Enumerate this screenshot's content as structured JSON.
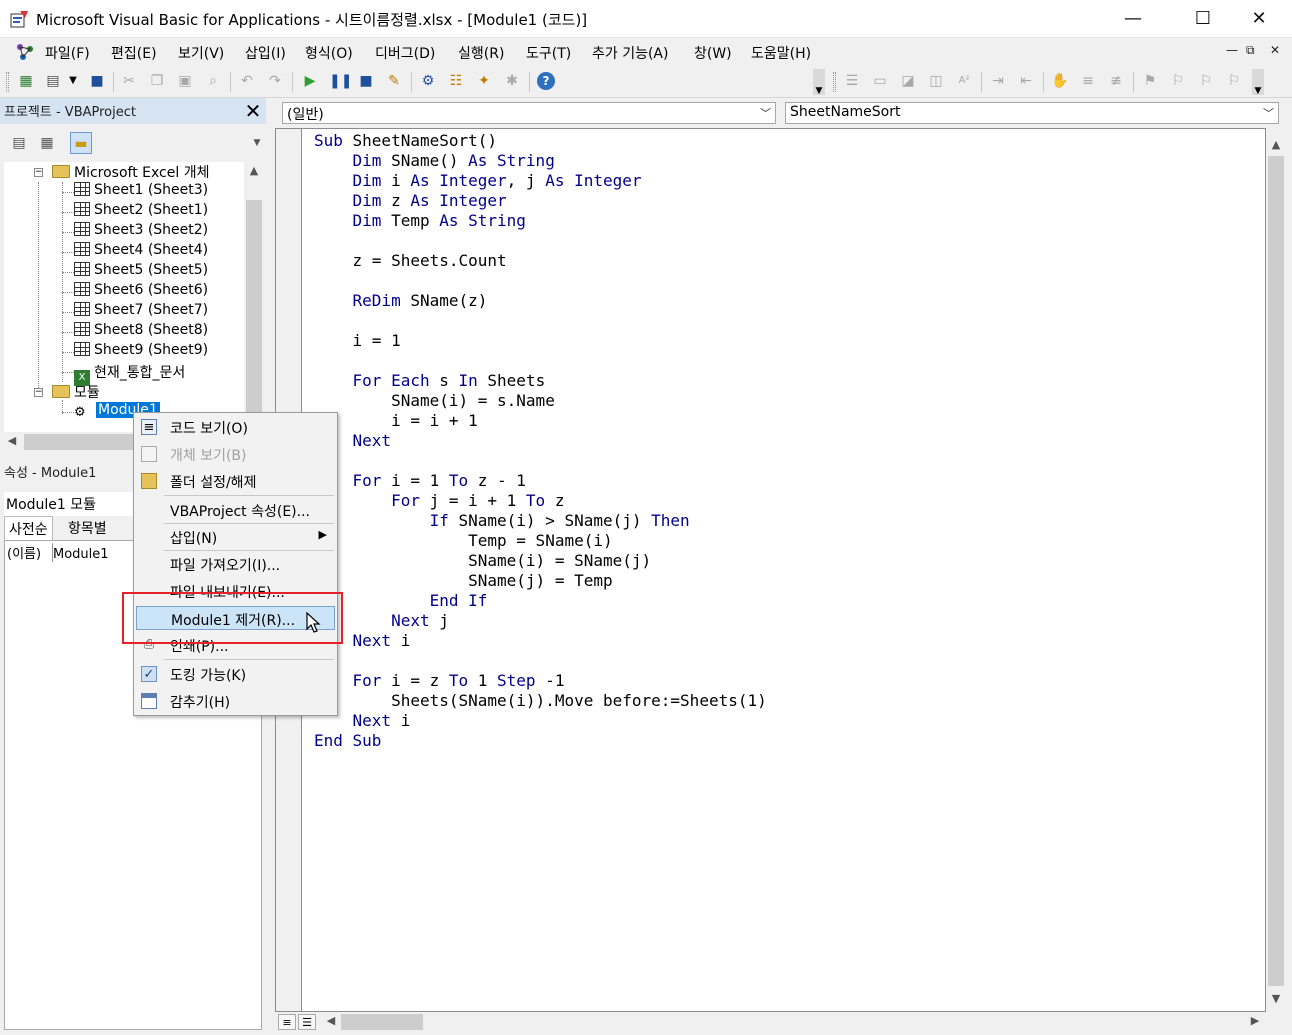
{
  "window": {
    "title": "Microsoft Visual Basic for Applications - 시트이름정렬.xlsx - [Module1 (코드)]",
    "minimize": "—",
    "maximize": "☐",
    "close": "✕"
  },
  "menu": {
    "items": [
      "파일(F)",
      "편집(E)",
      "보기(V)",
      "삽입(I)",
      "형식(O)",
      "디버그(D)",
      "실행(R)",
      "도구(T)",
      "추가 기능(A)",
      "창(W)",
      "도움말(H)"
    ],
    "mdi_min": "—",
    "mdi_restore": "⧉",
    "mdi_close": "✕"
  },
  "project": {
    "title": "프로젝트 - VBAProject",
    "close": "✕",
    "tree": {
      "excel_objects": "Microsoft Excel 개체",
      "sheets": [
        "Sheet1 (Sheet3)",
        "Sheet2 (Sheet1)",
        "Sheet3 (Sheet2)",
        "Sheet4 (Sheet4)",
        "Sheet5 (Sheet5)",
        "Sheet6 (Sheet6)",
        "Sheet7 (Sheet7)",
        "Sheet8 (Sheet8)",
        "Sheet9 (Sheet9)"
      ],
      "workbook": "현재_통합_문서",
      "modules_folder": "모듈",
      "module": "Module1"
    }
  },
  "properties": {
    "title": "속성 - Module1",
    "object": "Module1 모듈",
    "tab_alpha": "사전순",
    "tab_category": "항목별",
    "name_key": "(이름)",
    "name_value": "Module1"
  },
  "code": {
    "object_combo": "(일반)",
    "procedure_combo": "SheetNameSort",
    "lines": [
      [
        [
          "kw",
          "Sub "
        ],
        [
          "",
          "SheetNameSort()"
        ]
      ],
      [
        [
          "",
          "    "
        ],
        [
          "kw",
          "Dim "
        ],
        [
          "",
          "SName() "
        ],
        [
          "kw",
          "As String"
        ]
      ],
      [
        [
          "",
          "    "
        ],
        [
          "kw",
          "Dim "
        ],
        [
          "",
          "i "
        ],
        [
          "kw",
          "As Integer"
        ],
        [
          "",
          ", j "
        ],
        [
          "kw",
          "As Integer"
        ]
      ],
      [
        [
          "",
          "    "
        ],
        [
          "kw",
          "Dim "
        ],
        [
          "",
          "z "
        ],
        [
          "kw",
          "As Integer"
        ]
      ],
      [
        [
          "",
          "    "
        ],
        [
          "kw",
          "Dim "
        ],
        [
          "",
          "Temp "
        ],
        [
          "kw",
          "As String"
        ]
      ],
      [
        [
          "",
          ""
        ]
      ],
      [
        [
          "",
          "    z = Sheets.Count"
        ]
      ],
      [
        [
          "",
          ""
        ]
      ],
      [
        [
          "",
          "    "
        ],
        [
          "kw",
          "ReDim "
        ],
        [
          "",
          "SName(z)"
        ]
      ],
      [
        [
          "",
          ""
        ]
      ],
      [
        [
          "",
          "    i = 1"
        ]
      ],
      [
        [
          "",
          ""
        ]
      ],
      [
        [
          "",
          "    "
        ],
        [
          "kw",
          "For Each "
        ],
        [
          "",
          "s "
        ],
        [
          "kw",
          "In "
        ],
        [
          "",
          "Sheets"
        ]
      ],
      [
        [
          "",
          "        SName(i) = s.Name"
        ]
      ],
      [
        [
          "",
          "        i = i + 1"
        ]
      ],
      [
        [
          "",
          "    "
        ],
        [
          "kw",
          "Next"
        ]
      ],
      [
        [
          "",
          ""
        ]
      ],
      [
        [
          "",
          "    "
        ],
        [
          "kw",
          "For "
        ],
        [
          "",
          "i = 1 "
        ],
        [
          "kw",
          "To "
        ],
        [
          "",
          "z - 1"
        ]
      ],
      [
        [
          "",
          "        "
        ],
        [
          "kw",
          "For "
        ],
        [
          "",
          "j = i + 1 "
        ],
        [
          "kw",
          "To "
        ],
        [
          "",
          "z"
        ]
      ],
      [
        [
          "",
          "            "
        ],
        [
          "kw",
          "If "
        ],
        [
          "",
          "SName(i) > SName(j) "
        ],
        [
          "kw",
          "Then"
        ]
      ],
      [
        [
          "",
          "                Temp = SName(i)"
        ]
      ],
      [
        [
          "",
          "                SName(i) = SName(j)"
        ]
      ],
      [
        [
          "",
          "                SName(j) = Temp"
        ]
      ],
      [
        [
          "",
          "            "
        ],
        [
          "kw",
          "End If"
        ]
      ],
      [
        [
          "",
          "        "
        ],
        [
          "kw",
          "Next "
        ],
        [
          "",
          "j"
        ]
      ],
      [
        [
          "",
          "    "
        ],
        [
          "kw",
          "Next "
        ],
        [
          "",
          "i"
        ]
      ],
      [
        [
          "",
          ""
        ]
      ],
      [
        [
          "",
          "    "
        ],
        [
          "kw",
          "For "
        ],
        [
          "",
          "i = z "
        ],
        [
          "kw",
          "To "
        ],
        [
          "",
          "1 "
        ],
        [
          "kw",
          "Step "
        ],
        [
          "",
          "-1"
        ]
      ],
      [
        [
          "",
          "        Sheets(SName(i)).Move before:=Sheets(1)"
        ]
      ],
      [
        [
          "",
          "    "
        ],
        [
          "kw",
          "Next "
        ],
        [
          "",
          "i"
        ]
      ],
      [
        [
          "kw",
          "End Sub"
        ]
      ]
    ]
  },
  "context_menu": {
    "view_code": "코드 보기(O)",
    "view_object": "개체 보기(B)",
    "toggle_folders": "폴더 설정/해제",
    "project_props": "VBAProject 속성(E)...",
    "insert": "삽입(N)",
    "import_file": "파일 가져오기(I)...",
    "export_file": "파일 내보내기(E)...",
    "remove_module": "Module1 제거(R)...",
    "print": "인쇄(P)...",
    "dockable": "도킹 가능(K)",
    "hide": "감추기(H)"
  },
  "colors": {
    "keyword": "#00008b",
    "highlight_box": "#e8202a",
    "selection": "#0078d7"
  }
}
